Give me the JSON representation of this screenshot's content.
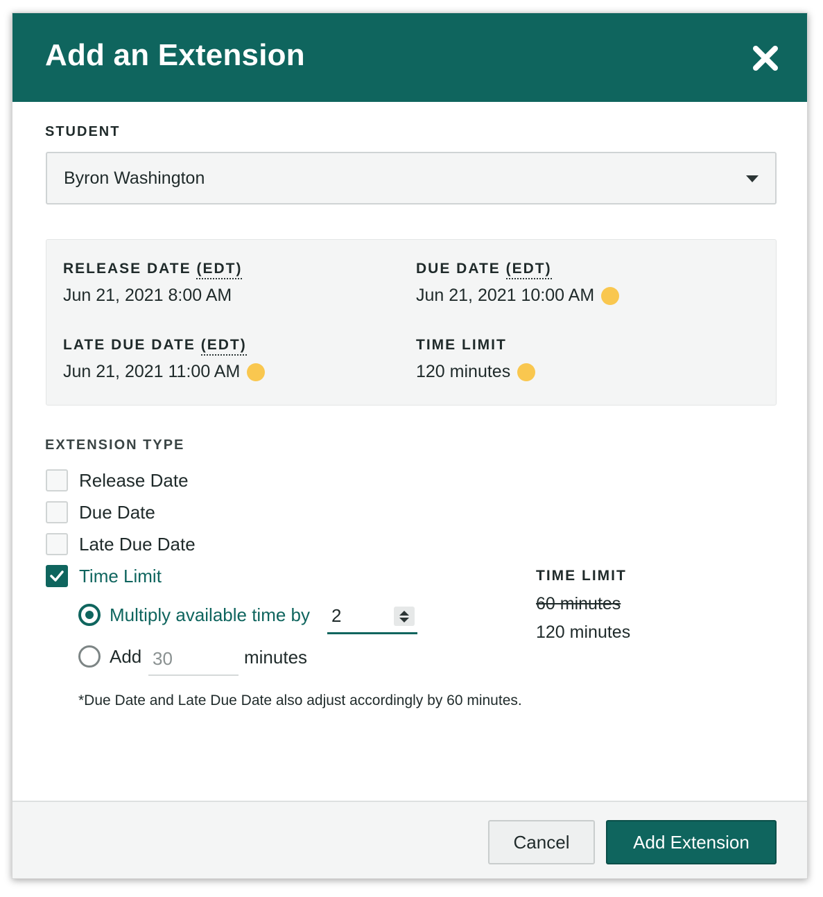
{
  "modal": {
    "title": "Add an Extension",
    "close_icon": "close-icon"
  },
  "student": {
    "label": "STUDENT",
    "selected": "Byron Washington"
  },
  "info": {
    "release": {
      "label_prefix": "RELEASE DATE ",
      "label_abbr": "(EDT)",
      "value": "Jun 21, 2021 8:00 AM"
    },
    "due": {
      "label_prefix": "DUE DATE ",
      "label_abbr": "(EDT)",
      "value": "Jun 21, 2021 10:00 AM"
    },
    "late_due": {
      "label_prefix": "LATE DUE DATE ",
      "label_abbr": "(EDT)",
      "value": "Jun 21, 2021 11:00 AM"
    },
    "time_limit": {
      "label": "TIME LIMIT",
      "value": "120 minutes"
    },
    "indicator_color": "#f9c74f"
  },
  "extension_type": {
    "label": "EXTENSION TYPE",
    "options": [
      {
        "label": "Release Date",
        "checked": false
      },
      {
        "label": "Due Date",
        "checked": false
      },
      {
        "label": "Late Due Date",
        "checked": false
      },
      {
        "label": "Time Limit",
        "checked": true
      }
    ]
  },
  "time_limit_options": {
    "multiply": {
      "label": "Multiply available time by",
      "value": "2",
      "selected": true
    },
    "add": {
      "label": "Add",
      "placeholder": "30",
      "suffix": "minutes",
      "selected": false
    },
    "note": "*Due Date and Late Due Date also adjust accordingly by 60 minutes."
  },
  "time_limit_summary": {
    "label": "TIME LIMIT",
    "old_value": "60 minutes",
    "new_value": "120 minutes"
  },
  "footer": {
    "cancel_label": "Cancel",
    "submit_label": "Add Extension"
  },
  "colors": {
    "brand": "#0f655e",
    "indicator": "#f9c74f"
  }
}
